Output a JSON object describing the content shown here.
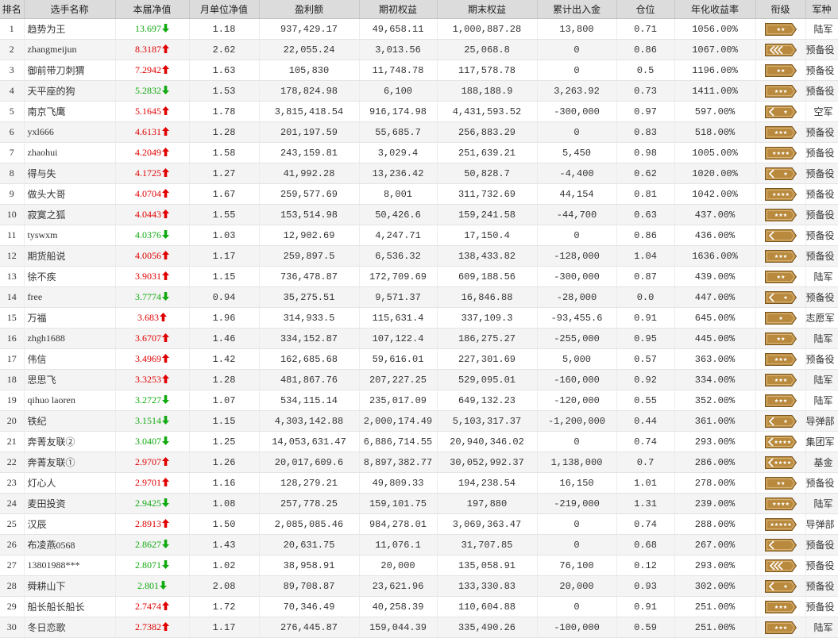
{
  "headers": [
    "排名",
    "选手名称",
    "本届净值",
    "月单位净值",
    "盈利额",
    "期初权益",
    "期末权益",
    "累计出入金",
    "仓位",
    "年化收益率",
    "衔级",
    "军种"
  ],
  "colors": {
    "up": "#e00000",
    "down": "#11aa11",
    "badge_fill": "#b98a3e",
    "badge_edge": "#7a5520"
  },
  "rows": [
    {
      "rank": "1",
      "name": "趋势为王",
      "nav": "13.697",
      "dir": "down",
      "monthly": "1.18",
      "profit": "937,429.17",
      "initial": "49,658.11",
      "final": "1,000,887.28",
      "flow": "13,800",
      "position": "0.71",
      "annual": "1056.00%",
      "badge": "2-star",
      "branch": "陆军"
    },
    {
      "rank": "2",
      "name": "zhangmeijun",
      "nav": "8.3187",
      "dir": "up",
      "monthly": "2.62",
      "profit": "22,055.24",
      "initial": "3,013.56",
      "final": "25,068.8",
      "flow": "0",
      "position": "0.86",
      "annual": "1067.00%",
      "badge": "3-chevron",
      "branch": "预备役"
    },
    {
      "rank": "3",
      "name": "御前带刀刺猬",
      "nav": "7.2942",
      "dir": "up",
      "monthly": "1.63",
      "profit": "105,830",
      "initial": "11,748.78",
      "final": "117,578.78",
      "flow": "0",
      "position": "0.5",
      "annual": "1196.00%",
      "badge": "2-star",
      "branch": "预备役"
    },
    {
      "rank": "4",
      "name": "天平座的狗",
      "nav": "5.2832",
      "dir": "down",
      "monthly": "1.53",
      "profit": "178,824.98",
      "initial": "6,100",
      "final": "188,188.9",
      "flow": "3,263.92",
      "position": "0.73",
      "annual": "1411.00%",
      "badge": "3-star",
      "branch": "预备役"
    },
    {
      "rank": "5",
      "name": "南京飞鹰",
      "nav": "5.1645",
      "dir": "up",
      "monthly": "1.78",
      "profit": "3,815,418.54",
      "initial": "916,174.98",
      "final": "4,431,593.52",
      "flow": "-300,000",
      "position": "0.97",
      "annual": "597.00%",
      "badge": "chevron-star",
      "branch": "空军"
    },
    {
      "rank": "6",
      "name": "yxl666",
      "nav": "4.6131",
      "dir": "up",
      "monthly": "1.28",
      "profit": "201,197.59",
      "initial": "55,685.7",
      "final": "256,883.29",
      "flow": "0",
      "position": "0.83",
      "annual": "518.00%",
      "badge": "3-star",
      "branch": "预备役"
    },
    {
      "rank": "7",
      "name": "zhaohui",
      "nav": "4.2049",
      "dir": "up",
      "monthly": "1.58",
      "profit": "243,159.81",
      "initial": "3,029.4",
      "final": "251,639.21",
      "flow": "5,450",
      "position": "0.98",
      "annual": "1005.00%",
      "badge": "4-star",
      "branch": "预备役"
    },
    {
      "rank": "8",
      "name": "得与失",
      "nav": "4.1725",
      "dir": "up",
      "monthly": "1.27",
      "profit": "41,992.28",
      "initial": "13,236.42",
      "final": "50,828.7",
      "flow": "-4,400",
      "position": "0.62",
      "annual": "1020.00%",
      "badge": "chevron-star",
      "branch": "预备役"
    },
    {
      "rank": "9",
      "name": "做头大哥",
      "nav": "4.0704",
      "dir": "up",
      "monthly": "1.67",
      "profit": "259,577.69",
      "initial": "8,001",
      "final": "311,732.69",
      "flow": "44,154",
      "position": "0.81",
      "annual": "1042.00%",
      "badge": "4-star",
      "branch": "预备役"
    },
    {
      "rank": "10",
      "name": "寂寞之狐",
      "nav": "4.0443",
      "dir": "up",
      "monthly": "1.55",
      "profit": "153,514.98",
      "initial": "50,426.6",
      "final": "159,241.58",
      "flow": "-44,700",
      "position": "0.63",
      "annual": "437.00%",
      "badge": "3-star",
      "branch": "预备役"
    },
    {
      "rank": "11",
      "name": "tyswxm",
      "nav": "4.0376",
      "dir": "down",
      "monthly": "1.03",
      "profit": "12,902.69",
      "initial": "4,247.71",
      "final": "17,150.4",
      "flow": "0",
      "position": "0.86",
      "annual": "436.00%",
      "badge": "chevron",
      "branch": "预备役"
    },
    {
      "rank": "12",
      "name": "期货船说",
      "nav": "4.0056",
      "dir": "up",
      "monthly": "1.17",
      "profit": "259,897.5",
      "initial": "6,536.32",
      "final": "138,433.82",
      "flow": "-128,000",
      "position": "1.04",
      "annual": "1636.00%",
      "badge": "3-star",
      "branch": "预备役"
    },
    {
      "rank": "13",
      "name": "徐不疾",
      "nav": "3.9031",
      "dir": "up",
      "monthly": "1.15",
      "profit": "736,478.87",
      "initial": "172,709.69",
      "final": "609,188.56",
      "flow": "-300,000",
      "position": "0.87",
      "annual": "439.00%",
      "badge": "2-star",
      "branch": "陆军"
    },
    {
      "rank": "14",
      "name": "free",
      "nav": "3.7774",
      "dir": "down",
      "monthly": "0.94",
      "profit": "35,275.51",
      "initial": "9,571.37",
      "final": "16,846.88",
      "flow": "-28,000",
      "position": "0.0",
      "annual": "447.00%",
      "badge": "chevron-star",
      "branch": "预备役"
    },
    {
      "rank": "15",
      "name": "万福",
      "nav": "3.683",
      "dir": "up",
      "monthly": "1.96",
      "profit": "314,933.5",
      "initial": "115,631.4",
      "final": "337,109.3",
      "flow": "-93,455.6",
      "position": "0.91",
      "annual": "645.00%",
      "badge": "1-star",
      "branch": "志愿军"
    },
    {
      "rank": "16",
      "name": "zhgh1688",
      "nav": "3.6707",
      "dir": "up",
      "monthly": "1.46",
      "profit": "334,152.87",
      "initial": "107,122.4",
      "final": "186,275.27",
      "flow": "-255,000",
      "position": "0.95",
      "annual": "445.00%",
      "badge": "2-star",
      "branch": "陆军"
    },
    {
      "rank": "17",
      "name": "伟信",
      "nav": "3.4969",
      "dir": "up",
      "monthly": "1.42",
      "profit": "162,685.68",
      "initial": "59,616.01",
      "final": "227,301.69",
      "flow": "5,000",
      "position": "0.57",
      "annual": "363.00%",
      "badge": "3-star",
      "branch": "预备役"
    },
    {
      "rank": "18",
      "name": "思思飞",
      "nav": "3.3253",
      "dir": "up",
      "monthly": "1.28",
      "profit": "481,867.76",
      "initial": "207,227.25",
      "final": "529,095.01",
      "flow": "-160,000",
      "position": "0.92",
      "annual": "334.00%",
      "badge": "3-star",
      "branch": "陆军"
    },
    {
      "rank": "19",
      "name": "qihuo laoren",
      "nav": "3.2727",
      "dir": "down",
      "monthly": "1.07",
      "profit": "534,115.14",
      "initial": "235,017.09",
      "final": "649,132.23",
      "flow": "-120,000",
      "position": "0.55",
      "annual": "352.00%",
      "badge": "3-star",
      "branch": "陆军"
    },
    {
      "rank": "20",
      "name": "铁纪",
      "nav": "3.1514",
      "dir": "down",
      "monthly": "1.15",
      "profit": "4,303,142.88",
      "initial": "2,000,174.49",
      "final": "5,103,317.37",
      "flow": "-1,200,000",
      "position": "0.44",
      "annual": "361.00%",
      "badge": "chevron-star",
      "branch": "导弹部"
    },
    {
      "rank": "21",
      "name": "奔菁友联②",
      "nav": "3.0407",
      "dir": "down",
      "monthly": "1.25",
      "profit": "14,053,631.47",
      "initial": "6,886,714.55",
      "final": "20,940,346.02",
      "flow": "0",
      "position": "0.74",
      "annual": "293.00%",
      "badge": "chevron-4star",
      "branch": "集团军"
    },
    {
      "rank": "22",
      "name": "奔菁友联①",
      "nav": "2.9707",
      "dir": "up",
      "monthly": "1.26",
      "profit": "20,017,609.6",
      "initial": "8,897,382.77",
      "final": "30,052,992.37",
      "flow": "1,138,000",
      "position": "0.7",
      "annual": "286.00%",
      "badge": "chevron-4star",
      "branch": "基金"
    },
    {
      "rank": "23",
      "name": "灯心人",
      "nav": "2.9701",
      "dir": "up",
      "monthly": "1.16",
      "profit": "128,279.21",
      "initial": "49,809.33",
      "final": "194,238.54",
      "flow": "16,150",
      "position": "1.01",
      "annual": "278.00%",
      "badge": "2-star",
      "branch": "预备役"
    },
    {
      "rank": "24",
      "name": "麦田投资",
      "nav": "2.9425",
      "dir": "down",
      "monthly": "1.08",
      "profit": "257,778.25",
      "initial": "159,101.75",
      "final": "197,880",
      "flow": "-219,000",
      "position": "1.31",
      "annual": "239.00%",
      "badge": "4-star",
      "branch": "陆军"
    },
    {
      "rank": "25",
      "name": "汉辰",
      "nav": "2.8913",
      "dir": "up",
      "monthly": "1.50",
      "profit": "2,085,085.46",
      "initial": "984,278.01",
      "final": "3,069,363.47",
      "flow": "0",
      "position": "0.74",
      "annual": "288.00%",
      "badge": "5-star",
      "branch": "导弹部"
    },
    {
      "rank": "26",
      "name": "布凌燕0568",
      "nav": "2.8627",
      "dir": "down",
      "monthly": "1.43",
      "profit": "20,631.75",
      "initial": "11,076.1",
      "final": "31,707.85",
      "flow": "0",
      "position": "0.68",
      "annual": "267.00%",
      "badge": "chevron",
      "branch": "预备役"
    },
    {
      "rank": "27",
      "name": "13801988***",
      "nav": "2.8071",
      "dir": "down",
      "monthly": "1.02",
      "profit": "38,958.91",
      "initial": "20,000",
      "final": "135,058.91",
      "flow": "76,100",
      "position": "0.12",
      "annual": "293.00%",
      "badge": "3-chevron",
      "branch": "预备役"
    },
    {
      "rank": "28",
      "name": "舜耕山下",
      "nav": "2.801",
      "dir": "down",
      "monthly": "2.08",
      "profit": "89,708.87",
      "initial": "23,621.96",
      "final": "133,330.83",
      "flow": "20,000",
      "position": "0.93",
      "annual": "302.00%",
      "badge": "chevron-star",
      "branch": "预备役"
    },
    {
      "rank": "29",
      "name": "船长船长船长",
      "nav": "2.7474",
      "dir": "up",
      "monthly": "1.72",
      "profit": "70,346.49",
      "initial": "40,258.39",
      "final": "110,604.88",
      "flow": "0",
      "position": "0.91",
      "annual": "251.00%",
      "badge": "3-star",
      "branch": "预备役"
    },
    {
      "rank": "30",
      "name": "冬日恋歌",
      "nav": "2.7382",
      "dir": "up",
      "monthly": "1.17",
      "profit": "276,445.87",
      "initial": "159,044.39",
      "final": "335,490.26",
      "flow": "-100,000",
      "position": "0.59",
      "annual": "251.00%",
      "badge": "3-star",
      "branch": "陆军"
    }
  ]
}
